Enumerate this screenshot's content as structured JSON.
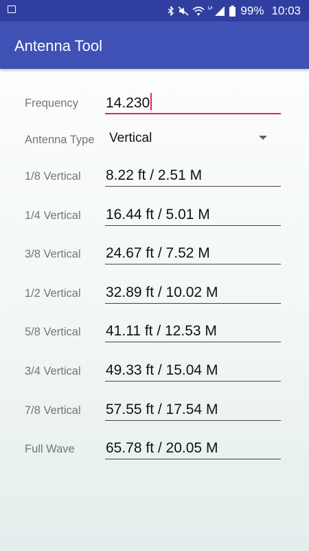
{
  "status_bar": {
    "battery_percent": "99%",
    "time": "10:03",
    "icons": [
      "gallery-icon",
      "bluetooth-icon",
      "mute-icon",
      "wifi-icon",
      "lte-signal-icon",
      "battery-icon"
    ]
  },
  "app": {
    "title": "Antenna Tool",
    "colors": {
      "primary": "#3f51b5",
      "primary_dark": "#303f9f",
      "accent": "#e91e63"
    }
  },
  "frequency": {
    "label": "Frequency",
    "value": "14.230"
  },
  "antenna_type": {
    "label": "Antenna Type",
    "selected": "Vertical"
  },
  "results": [
    {
      "label": "1/8 Vertical",
      "value": "8.22 ft / 2.51 M"
    },
    {
      "label": "1/4 Vertical",
      "value": "16.44 ft / 5.01 M"
    },
    {
      "label": "3/8 Vertical",
      "value": "24.67 ft / 7.52 M"
    },
    {
      "label": "1/2 Vertical",
      "value": "32.89 ft / 10.02 M"
    },
    {
      "label": "5/8 Vertical",
      "value": "41.11 ft / 12.53 M"
    },
    {
      "label": "3/4 Vertical",
      "value": "49.33 ft / 15.04 M"
    },
    {
      "label": "7/8 Vertical",
      "value": "57.55 ft / 17.54 M"
    },
    {
      "label": "Full Wave",
      "value": "65.78 ft / 20.05 M"
    }
  ]
}
